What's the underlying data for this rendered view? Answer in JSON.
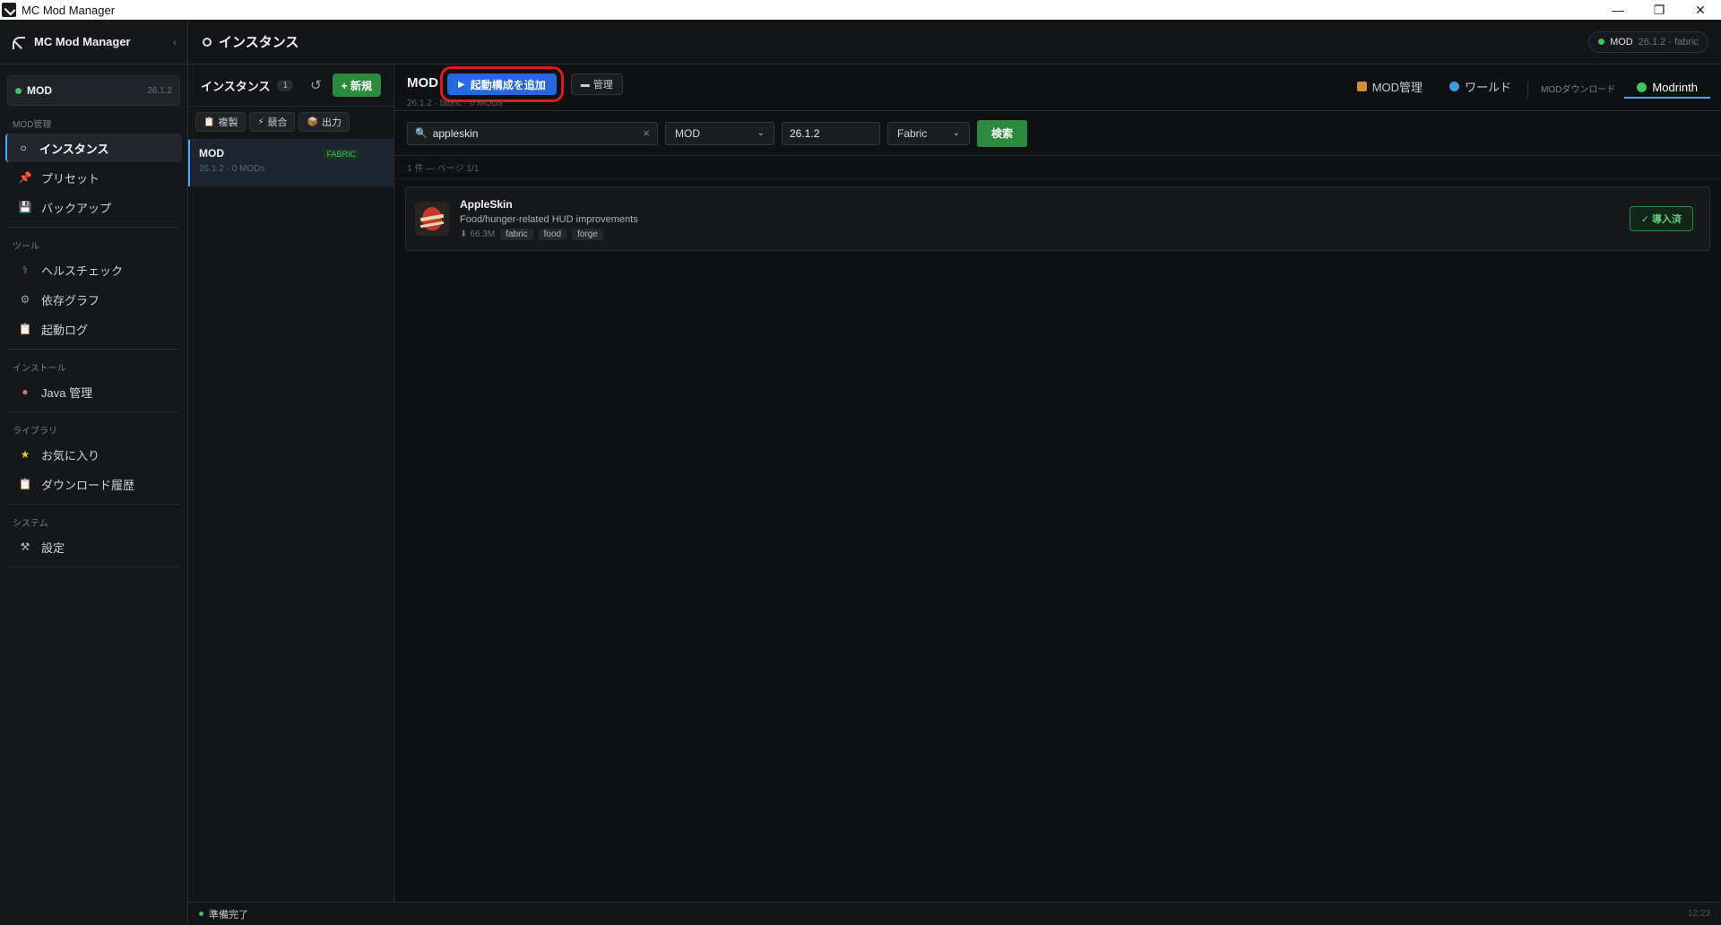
{
  "window": {
    "title": "MC Mod Manager",
    "minimize": "—",
    "maximize": "❐",
    "close": "✕"
  },
  "sidebar": {
    "app_title": "MC Mod Manager",
    "collapse": "‹",
    "instance_name": "MOD",
    "instance_version": "26.1.2",
    "sections": [
      {
        "label": "MOD管理",
        "items": [
          {
            "label": "インスタンス",
            "icon": "instance-icon"
          },
          {
            "label": "プリセット",
            "icon": "pin-icon"
          },
          {
            "label": "バックアップ",
            "icon": "floppy-icon"
          }
        ]
      },
      {
        "label": "ツール",
        "items": [
          {
            "label": "ヘルスチェック",
            "icon": "stethoscope-icon"
          },
          {
            "label": "依存グラフ",
            "icon": "graph-icon"
          },
          {
            "label": "起動ログ",
            "icon": "log-icon"
          }
        ]
      },
      {
        "label": "インストール",
        "items": [
          {
            "label": "Java 管理",
            "icon": "java-icon"
          }
        ]
      },
      {
        "label": "ライブラリ",
        "items": [
          {
            "label": "お気に入り",
            "icon": "star-icon"
          },
          {
            "label": "ダウンロード履歴",
            "icon": "clipboard-icon"
          }
        ]
      },
      {
        "label": "システム",
        "items": [
          {
            "label": "設定",
            "icon": "tools-icon"
          }
        ]
      }
    ]
  },
  "header": {
    "title": "インスタンス",
    "status": {
      "name": "MOD",
      "detail": "26.1.2 · fabric"
    }
  },
  "instances": {
    "label": "インスタンス",
    "count": "1",
    "refresh": "↺",
    "new_label": "+ 新規",
    "tools": [
      {
        "label": "複製",
        "icon": "📋"
      },
      {
        "label": "競合",
        "icon": "⚡"
      },
      {
        "label": "出力",
        "icon": "📦"
      }
    ],
    "items": [
      {
        "name": "MOD",
        "loader": "FABRIC",
        "sub": "26.1.2 · 0 MODs"
      }
    ]
  },
  "main": {
    "title": "MOD",
    "subtitle": "26.1.2 · fabric · 0 MODs",
    "launch_label": "起動構成を追加",
    "manage_label": "管理",
    "tabs": [
      {
        "label": "MOD管理",
        "color": "#d98b3a"
      },
      {
        "label": "ワールド",
        "color": "#3b9ad9"
      },
      {
        "label": "MODダウンロード",
        "color": ""
      },
      {
        "label": "Modrinth",
        "color": "#3fc35a"
      }
    ],
    "search": {
      "query": "appleskin",
      "clear": "×",
      "type": "MOD",
      "version": "26.1.2",
      "loader": "Fabric",
      "button": "検索"
    },
    "result_meta": "1 件 — ページ 1/1",
    "results": [
      {
        "name": "AppleSkin",
        "description": "Food/hunger-related HUD improvements",
        "downloads": "66.3M",
        "tags": [
          "fabric",
          "food",
          "forge"
        ],
        "action": "✓ 導入済"
      }
    ]
  },
  "statusbar": {
    "text": "準備完了",
    "time": "12:23"
  }
}
